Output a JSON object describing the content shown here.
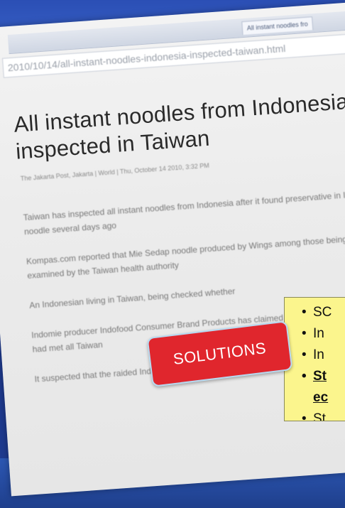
{
  "browser": {
    "tab_title": "All instant noodles fro",
    "url": "2010/10/14/all-instant-noodles-indonesia-inspected-taiwan.html"
  },
  "article": {
    "headline": "All instant noodles from Indonesia inspected in Taiwan",
    "byline": "The Jakarta Post, Jakarta | World | Thu, October 14 2010, 3:32 PM",
    "paragraphs": [
      "Taiwan has inspected all instant noodles from Indonesia after it found preservative in Indomie noodle several days ago",
      "Kompas.com reported that Mie Sedap noodle produced by Wings among those being examined by the Taiwan health authority",
      "An Indonesian living in Taiwan, being checked whether",
      "Indomie producer Indofood Consumer Brand Products has claimed that its Indomie noodle had met all Taiwan",
      "It suspected that the raided Indomie noodle country, which has a different standard on pre"
    ]
  },
  "overlay": {
    "badge_label": "SOLUTIONS",
    "items": [
      {
        "text": "SC",
        "style": "normal"
      },
      {
        "text": "In",
        "style": "normal"
      },
      {
        "text": "In",
        "style": "normal"
      },
      {
        "text": "St",
        "style": "strong"
      },
      {
        "text": "ec",
        "style": "strong-cont"
      },
      {
        "text": "St",
        "style": "normal"
      }
    ]
  },
  "colors": {
    "badge": "#e0262d",
    "box": "#fbf58d",
    "background": "#1e3a8f"
  }
}
